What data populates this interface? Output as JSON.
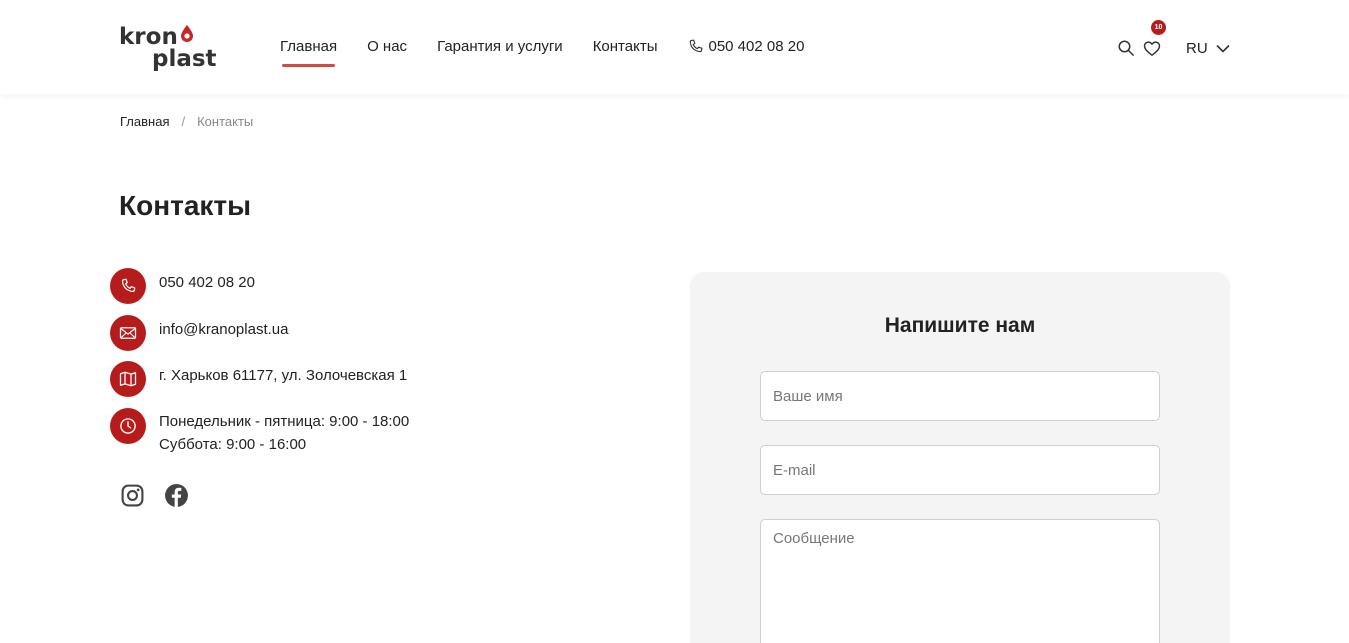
{
  "brand": {
    "logo_top": "kron",
    "logo_bottom": "plast",
    "accent": "#b71c1c",
    "nav_underline": "#d24b43"
  },
  "nav": {
    "items": [
      {
        "label": "Главная",
        "active": true
      },
      {
        "label": "О нас"
      },
      {
        "label": "Гарантия и услуги"
      },
      {
        "label": "Контакты"
      }
    ],
    "phone": "050 402 08 20",
    "phone_icon": "phone-icon"
  },
  "header_actions": {
    "search_icon": "search-icon",
    "favorites_icon": "heart-icon",
    "favorites_count": "10",
    "language": "RU",
    "language_icon": "chevron-down-icon"
  },
  "breadcrumb": {
    "home": "Главная",
    "separator": "/",
    "current": "Контакты"
  },
  "page_title": "Контакты",
  "contacts": {
    "phone": "050 402 08 20",
    "email": "info@kranoplast.ua",
    "address": "г. Харьков 61177, ул. Золочевская 1",
    "hours_weekdays": "Понедельник - пятница: 9:00 - 18:00",
    "hours_saturday": "Суббота: 9:00 - 16:00"
  },
  "socials": {
    "instagram_icon": "instagram-icon",
    "facebook_icon": "facebook-icon"
  },
  "form": {
    "title": "Напишите нам",
    "name_placeholder": "Ваше имя",
    "email_placeholder": "E-mail",
    "message_placeholder": "Сообщение"
  }
}
